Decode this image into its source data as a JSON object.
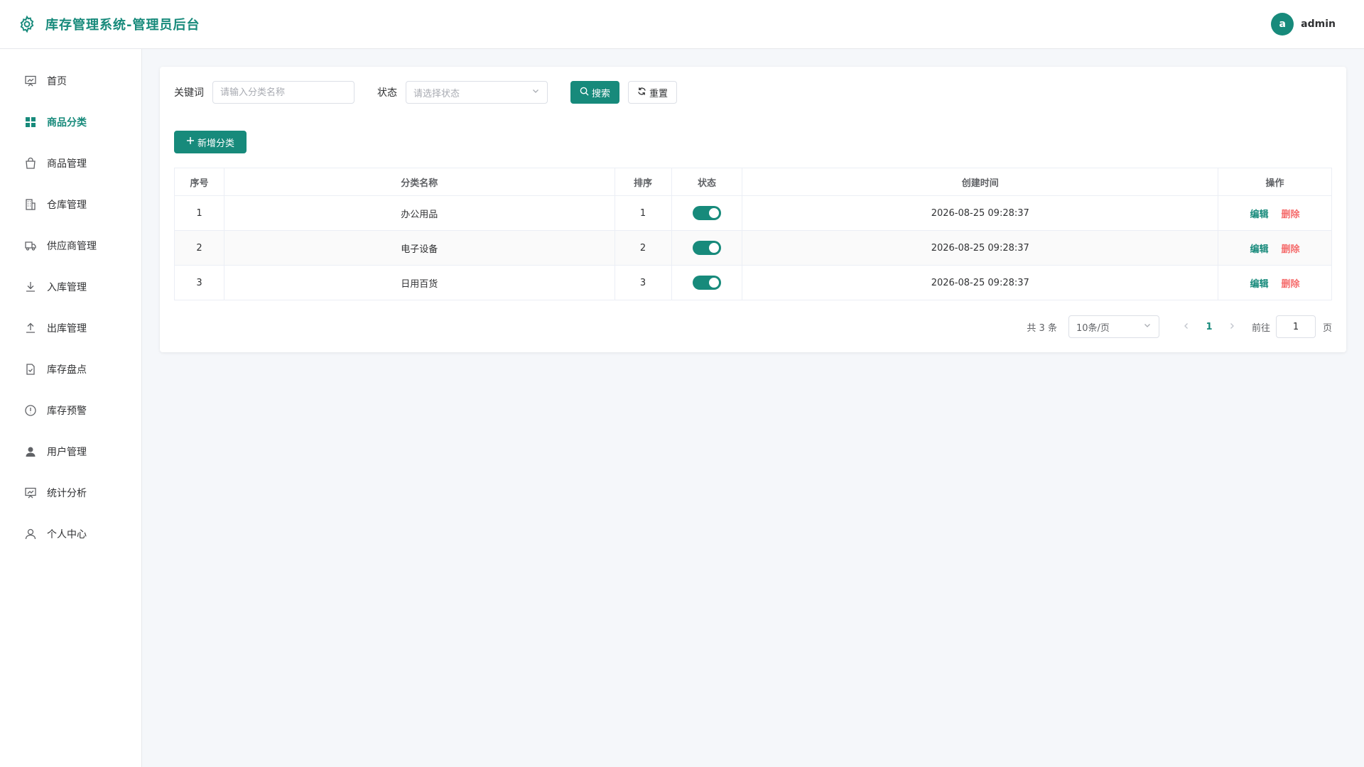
{
  "header": {
    "title": "库存管理系统-管理员后台",
    "logo_icon": "gear-icon",
    "user": {
      "avatar_letter": "a",
      "name": "admin"
    }
  },
  "colors": {
    "primary": "#178a7b",
    "danger": "#f56c6c"
  },
  "sidebar": {
    "items": [
      {
        "label": "首页",
        "icon": "dashboard-icon",
        "active": false
      },
      {
        "label": "商品分类",
        "icon": "grid-icon",
        "active": true
      },
      {
        "label": "商品管理",
        "icon": "shopping-bag-icon",
        "active": false
      },
      {
        "label": "仓库管理",
        "icon": "building-icon",
        "active": false
      },
      {
        "label": "供应商管理",
        "icon": "truck-icon",
        "active": false
      },
      {
        "label": "入库管理",
        "icon": "download-icon",
        "active": false
      },
      {
        "label": "出库管理",
        "icon": "upload-icon",
        "active": false
      },
      {
        "label": "库存盘点",
        "icon": "document-check-icon",
        "active": false
      },
      {
        "label": "库存预警",
        "icon": "warning-icon",
        "active": false
      },
      {
        "label": "用户管理",
        "icon": "user-filled-icon",
        "active": false
      },
      {
        "label": "统计分析",
        "icon": "chart-icon",
        "active": false
      },
      {
        "label": "个人中心",
        "icon": "user-icon",
        "active": false
      }
    ]
  },
  "search": {
    "keyword_label": "关键词",
    "keyword_placeholder": "请输入分类名称",
    "status_label": "状态",
    "status_placeholder": "请选择状态",
    "search_button": "搜索",
    "reset_button": "重置"
  },
  "toolbar": {
    "add_button": "新增分类"
  },
  "table": {
    "headers": [
      "序号",
      "分类名称",
      "排序",
      "状态",
      "创建时间",
      "操作"
    ],
    "rows": [
      {
        "index": "1",
        "name": "办公用品",
        "sort": "1",
        "enabled": true,
        "created": "2026-08-25 09:28:37"
      },
      {
        "index": "2",
        "name": "电子设备",
        "sort": "2",
        "enabled": true,
        "created": "2026-08-25 09:28:37"
      },
      {
        "index": "3",
        "name": "日用百货",
        "sort": "3",
        "enabled": true,
        "created": "2026-08-25 09:28:37"
      }
    ],
    "edit_label": "编辑",
    "delete_label": "删除"
  },
  "pagination": {
    "total_text": "共 3 条",
    "page_size": "10条/页",
    "current_page": "1",
    "goto_label": "前往",
    "goto_value": "1",
    "page_unit": "页"
  }
}
